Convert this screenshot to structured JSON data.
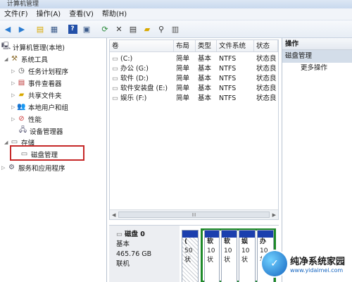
{
  "window": {
    "title": "计算机管理"
  },
  "menu": [
    "文件(F)",
    "操作(A)",
    "查看(V)",
    "帮助(H)"
  ],
  "tree": {
    "root": "计算机管理(本地)",
    "system_tools": "系统工具",
    "items": [
      "任务计划程序",
      "事件查看器",
      "共享文件夹",
      "本地用户和组",
      "性能",
      "设备管理器"
    ],
    "storage": "存储",
    "disk_mgmt": "磁盘管理",
    "services": "服务和应用程序"
  },
  "list": {
    "columns": [
      "卷",
      "布局",
      "类型",
      "文件系统",
      "状态"
    ],
    "rows": [
      [
        "(C:)",
        "简单",
        "基本",
        "NTFS",
        "状态良"
      ],
      [
        "办公 (G:)",
        "简单",
        "基本",
        "NTFS",
        "状态良"
      ],
      [
        "软件 (D:)",
        "简单",
        "基本",
        "NTFS",
        "状态良"
      ],
      [
        "软件安装盘 (E:)",
        "简单",
        "基本",
        "NTFS",
        "状态良"
      ],
      [
        "娱乐 (F:)",
        "简单",
        "基本",
        "NTFS",
        "状态良"
      ]
    ],
    "scroll_left": "◀",
    "scroll_right": "▶",
    "scroll_grip": "III"
  },
  "disk": {
    "name": "磁盘 0",
    "type": "基本",
    "size": "465.76 GB",
    "status": "联机",
    "partitions": [
      {
        "l1": "(",
        "l2": "50",
        "l3": "状"
      },
      {
        "l1": "软",
        "l2": "10",
        "l3": "状"
      },
      {
        "l1": "软",
        "l2": "10",
        "l3": "状"
      },
      {
        "l1": "娱",
        "l2": "10",
        "l3": "状"
      },
      {
        "l1": "办",
        "l2": "10",
        "l3": "状"
      }
    ]
  },
  "actions": {
    "header": "操作",
    "selected": "磁盘管理",
    "more": "更多操作"
  },
  "watermark": {
    "logo": "✓",
    "cn": "纯净系统家园",
    "url": "www.yidaimei.com"
  },
  "colors": {
    "partition_bar": "#1b3fae",
    "extended_border": "#1f8a2a",
    "highlight": "#c62828"
  }
}
